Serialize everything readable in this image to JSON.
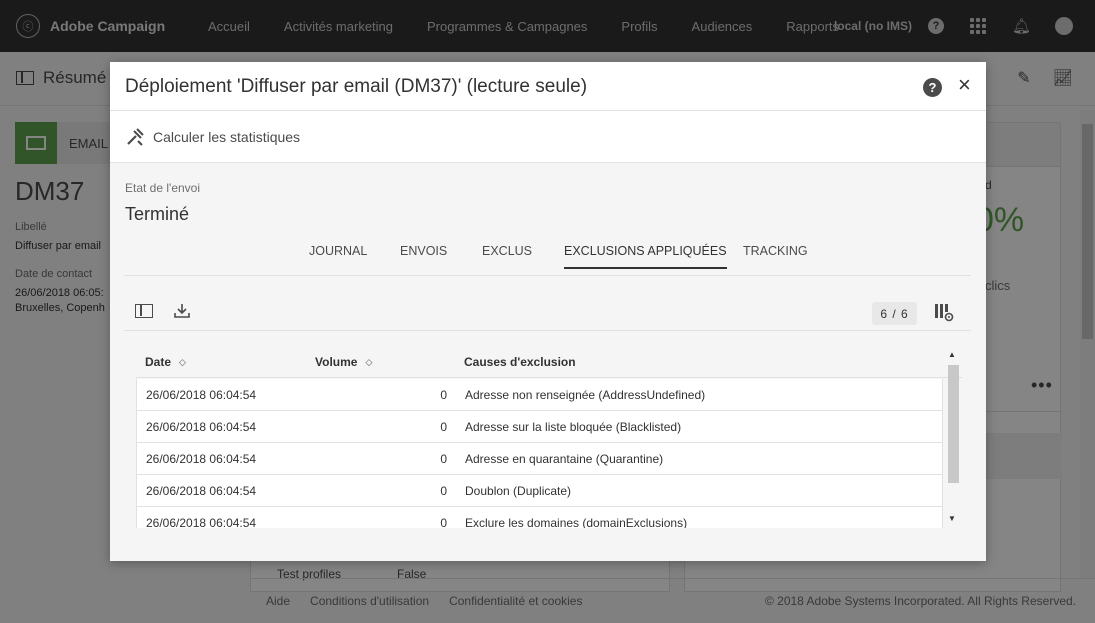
{
  "app": {
    "brand": "Adobe Campaign",
    "nav": [
      "Accueil",
      "Activités marketing",
      "Programmes & Campagnes",
      "Profils",
      "Audiences",
      "Rapports"
    ],
    "env": "local (no IMS)"
  },
  "background": {
    "page_title": "Résumé",
    "channel": "EMAIL",
    "code": "DM37",
    "label_lbl": "Libellé",
    "label_val": "Diffuser par email",
    "contact_lbl": "Date de contact",
    "contact_val_1": "26/06/2018 06:05:",
    "contact_val_2": "Bruxelles, Copenh",
    "right_small": "d",
    "right_pct": "0%",
    "right_clics": "clics",
    "more": "•••",
    "row_label": "Test profiles",
    "row_value": "False"
  },
  "footer": {
    "help": "Aide",
    "terms": "Conditions d'utilisation",
    "privacy": "Confidentialité et cookies",
    "copyright": "© 2018 Adobe Systems Incorporated. All Rights Reserved."
  },
  "dialog": {
    "title": "Déploiement 'Diffuser par email (DM37)' (lecture seule)",
    "help": "?",
    "close": "×",
    "compute_stats": "Calculer les statistiques",
    "state_label": "Etat de l'envoi",
    "state_value": "Terminé",
    "tabs": [
      "JOURNAL",
      "ENVOIS",
      "EXCLUS",
      "EXCLUSIONS APPLIQUÉES",
      "TRACKING"
    ],
    "active_tab": 3,
    "count": "6 / 6",
    "columns": [
      "Date",
      "Volume",
      "Causes d'exclusion"
    ],
    "rows": [
      {
        "date": "26/06/2018 06:04:54",
        "volume": "0",
        "cause": "Adresse non renseignée (AddressUndefined)"
      },
      {
        "date": "26/06/2018 06:04:54",
        "volume": "0",
        "cause": "Adresse sur la liste bloquée (Blacklisted)"
      },
      {
        "date": "26/06/2018 06:04:54",
        "volume": "0",
        "cause": "Adresse en quarantaine (Quarantine)"
      },
      {
        "date": "26/06/2018 06:04:54",
        "volume": "0",
        "cause": "Doublon (Duplicate)"
      },
      {
        "date": "26/06/2018 06:04:54",
        "volume": "0",
        "cause": "Exclure les domaines (domainExclusions)"
      }
    ]
  }
}
